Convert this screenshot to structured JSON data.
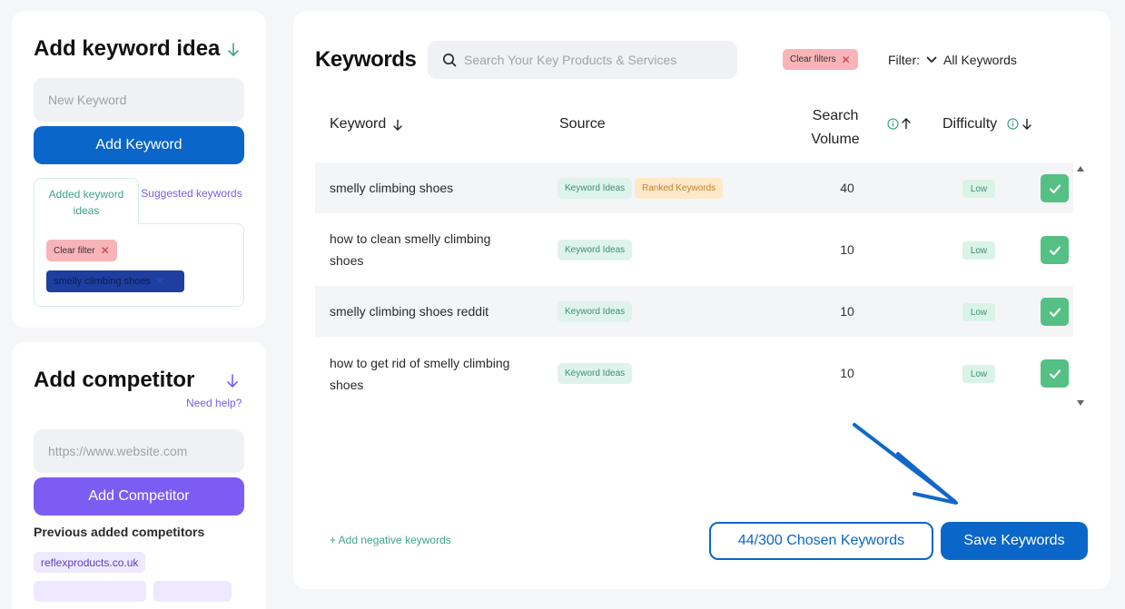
{
  "colors": {
    "primary": "#0a66c9",
    "purple": "#7d5cf3",
    "green": "#55c083",
    "teal": "#3ea38a",
    "clear_chip": "#f8b4b8"
  },
  "keyword_panel": {
    "title": "Add keyword idea",
    "input_placeholder": "New Keyword",
    "add_button": "Add Keyword",
    "tabs": [
      {
        "label": "Added keyword ideas",
        "active": true
      },
      {
        "label": "Suggested keywords",
        "active": false
      }
    ],
    "clear_filter": "Clear filter",
    "filter_chip": "smelly climbing shoes"
  },
  "competitor_panel": {
    "title": "Add competitor",
    "need_help": "Need help?",
    "input_placeholder": "https://www.website.com",
    "add_button": "Add Competitor",
    "previous_label": "Previous added competitors",
    "competitors": [
      "reflexproducts.co.uk"
    ]
  },
  "main": {
    "title": "Keywords",
    "search_placeholder": "Search Your Key Products & Services",
    "clear_filters": "Clear filters",
    "filter_label": "Filter:",
    "filter_value": "All Keywords",
    "columns": {
      "keyword": "Keyword",
      "source": "Source",
      "volume": "Search Volume",
      "difficulty": "Difficulty"
    },
    "rows": [
      {
        "keyword": "smelly climbing shoes",
        "sources": [
          "Keyword Ideas",
          "Ranked Keywords"
        ],
        "volume": "40",
        "difficulty": "Low",
        "checked": true
      },
      {
        "keyword": "how to clean smelly climbing shoes",
        "sources": [
          "Keyword Ideas"
        ],
        "volume": "10",
        "difficulty": "Low",
        "checked": true
      },
      {
        "keyword": "smelly climbing shoes reddit",
        "sources": [
          "Keyword Ideas"
        ],
        "volume": "10",
        "difficulty": "Low",
        "checked": true
      },
      {
        "keyword": "how to get rid of smelly climbing shoes",
        "sources": [
          "Keyword Ideas"
        ],
        "volume": "10",
        "difficulty": "Low",
        "checked": true
      }
    ],
    "add_negative": "+ Add negative keywords",
    "chosen_button": "44/300 Chosen Keywords",
    "save_button": "Save Keywords"
  }
}
